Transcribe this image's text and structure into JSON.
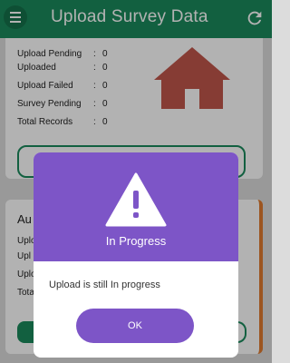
{
  "appbar": {
    "title": "Upload Survey Data"
  },
  "summary": {
    "rows": [
      {
        "label": "Upload Pending",
        "value": "0"
      },
      {
        "label": "Uploaded",
        "value": "0"
      },
      {
        "label": "Upload Failed",
        "value": "0"
      },
      {
        "label": "Survey Pending",
        "value": "0"
      },
      {
        "label": "Total Records",
        "value": "0"
      }
    ]
  },
  "card2": {
    "title": "Au",
    "rows": [
      "Uplo",
      "Upl",
      "Uplo",
      "Tota"
    ]
  },
  "dialog": {
    "title": "In Progress",
    "message": "Upload is still In progress",
    "ok_label": "OK"
  },
  "colors": {
    "primary": "#1a8a5c",
    "dialog": "#7d55c7",
    "house": "#c0564b",
    "accent": "#e07a2e"
  }
}
